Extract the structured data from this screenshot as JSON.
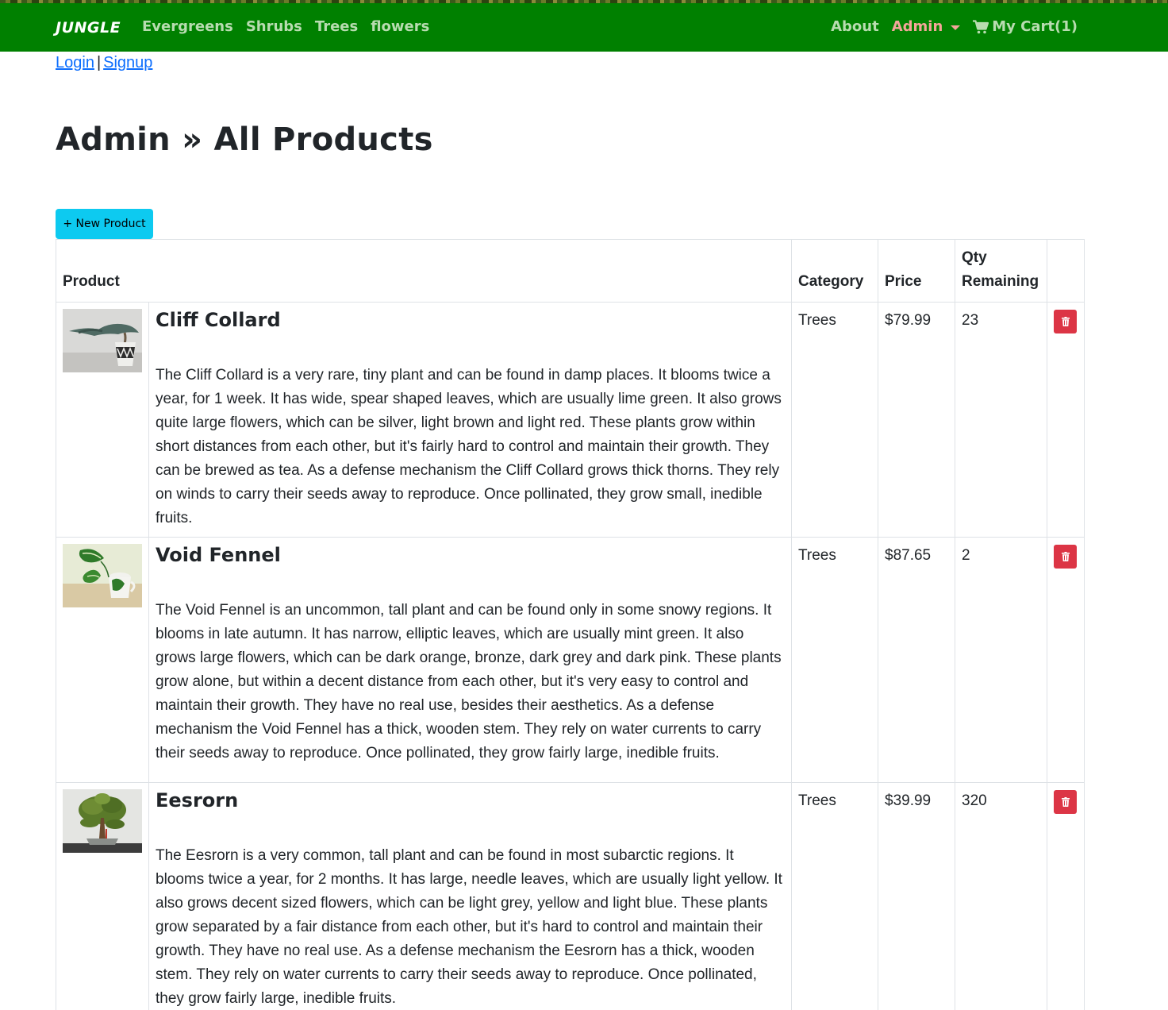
{
  "navbar": {
    "brand": "JUNGLE",
    "links": [
      "Evergreens",
      "Shrubs",
      "Trees",
      "flowers"
    ],
    "about": "About",
    "admin": "Admin",
    "cart": "My Cart(1)",
    "colors": {
      "background": "#008000",
      "link": "#b8dcb0",
      "admin": "#f4a69a"
    }
  },
  "auth": {
    "login": "Login",
    "separator": "|",
    "signup": "Signup"
  },
  "page_title": "Admin » All Products",
  "new_product_button": "+ New Product",
  "table": {
    "headers": {
      "product": "Product",
      "category": "Category",
      "price": "Price",
      "qty": "Qty Remaining"
    },
    "rows": [
      {
        "name": "Cliff Collard",
        "description": "The Cliff Collard is a very rare, tiny plant and can be found in damp places. It blooms twice a year, for 1 week. It has wide, spear shaped leaves, which are usually lime green. It also grows quite large flowers, which can be silver, light brown and light red. These plants grow within short distances from each other, but it's fairly hard to control and maintain their growth. They can be brewed as tea. As a defense mechanism the Cliff Collard grows thick thorns. They rely on winds to carry their seeds away to reproduce. Once pollinated, they grow small, inedible fruits.",
        "category": "Trees",
        "price": "$79.99",
        "qty": "23",
        "image": "bonsai-pot-image"
      },
      {
        "name": "Void Fennel",
        "description": "The Void Fennel is an uncommon, tall plant and can be found only in some snowy regions. It blooms in late autumn. It has narrow, elliptic leaves, which are usually mint green. It also grows large flowers, which can be dark orange, bronze, dark grey and dark pink. These plants grow alone, but within a decent distance from each other, but it's very easy to control and maintain their growth. They have no real use, besides their aesthetics. As a defense mechanism the Void Fennel has a thick, wooden stem. They rely on water currents to carry their seeds away to reproduce. Once pollinated, they grow fairly large, inedible fruits.",
        "category": "Trees",
        "price": "$87.65",
        "qty": "2",
        "image": "leaf-cup-image"
      },
      {
        "name": "Eesrorn",
        "description": "The Eesrorn is a very common, tall plant and can be found in most subarctic regions. It blooms twice a year, for 2 months. It has large, needle leaves, which are usually light yellow. It also grows decent sized flowers, which can be light grey, yellow and light blue. These plants grow separated by a fair distance from each other, but it's hard to control and maintain their growth. They have no real use. As a defense mechanism the Eesrorn has a thick, wooden stem. They rely on water currents to carry their seeds away to reproduce. Once pollinated, they grow fairly large, inedible fruits.",
        "category": "Trees",
        "price": "$39.99",
        "qty": "320",
        "image": "bonsai-tree-image"
      }
    ],
    "delete_icon": "trash-icon"
  }
}
